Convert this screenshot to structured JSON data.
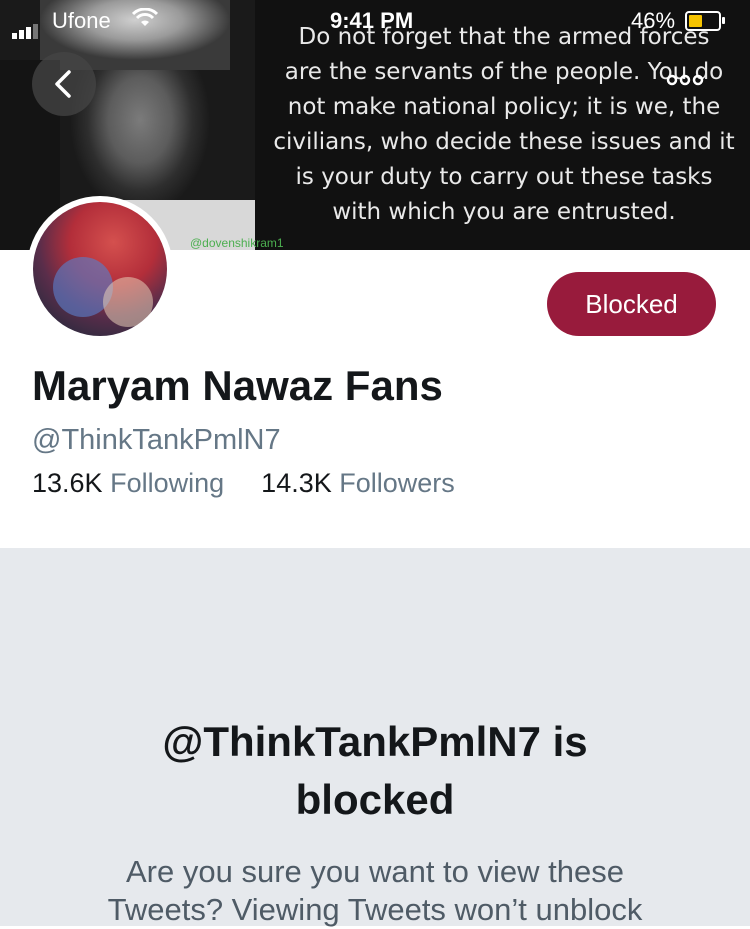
{
  "status_bar": {
    "carrier": "Ufone",
    "time": "9:41 PM",
    "battery_percent": "46%",
    "battery_level": 0.46,
    "battery_color": "#f5c300"
  },
  "banner": {
    "quote_lines": [
      "Do not forget that the armed forces",
      "are the servants of the people. You do",
      "not make national policy; it is we, the",
      "civilians, who decide these issues and it",
      "is your duty to carry out these tasks",
      "with which you are entrusted."
    ],
    "watermark": "@dovenshikram1"
  },
  "icons": {
    "back": "chevron-left-icon",
    "more": "more-options-icon",
    "wifi": "wifi-icon",
    "signal": "signal-icon",
    "battery": "battery-icon"
  },
  "profile": {
    "display_name": "Maryam Nawaz Fans",
    "handle": "@ThinkTankPmlN7",
    "following_count": "13.6K",
    "following_label": "Following",
    "followers_count": "14.3K",
    "followers_label": "Followers",
    "blocked_label": "Blocked"
  },
  "notice": {
    "title_line1": "@ThinkTankPmlN7 is",
    "title_line2": "blocked",
    "body_line1": "Are you sure you want to view these",
    "body_line2": "Tweets? Viewing Tweets won’t unblock"
  },
  "colors": {
    "blocked_button": "#981b3c",
    "secondary_text": "#657786",
    "notice_bg": "#e6e9ed"
  }
}
